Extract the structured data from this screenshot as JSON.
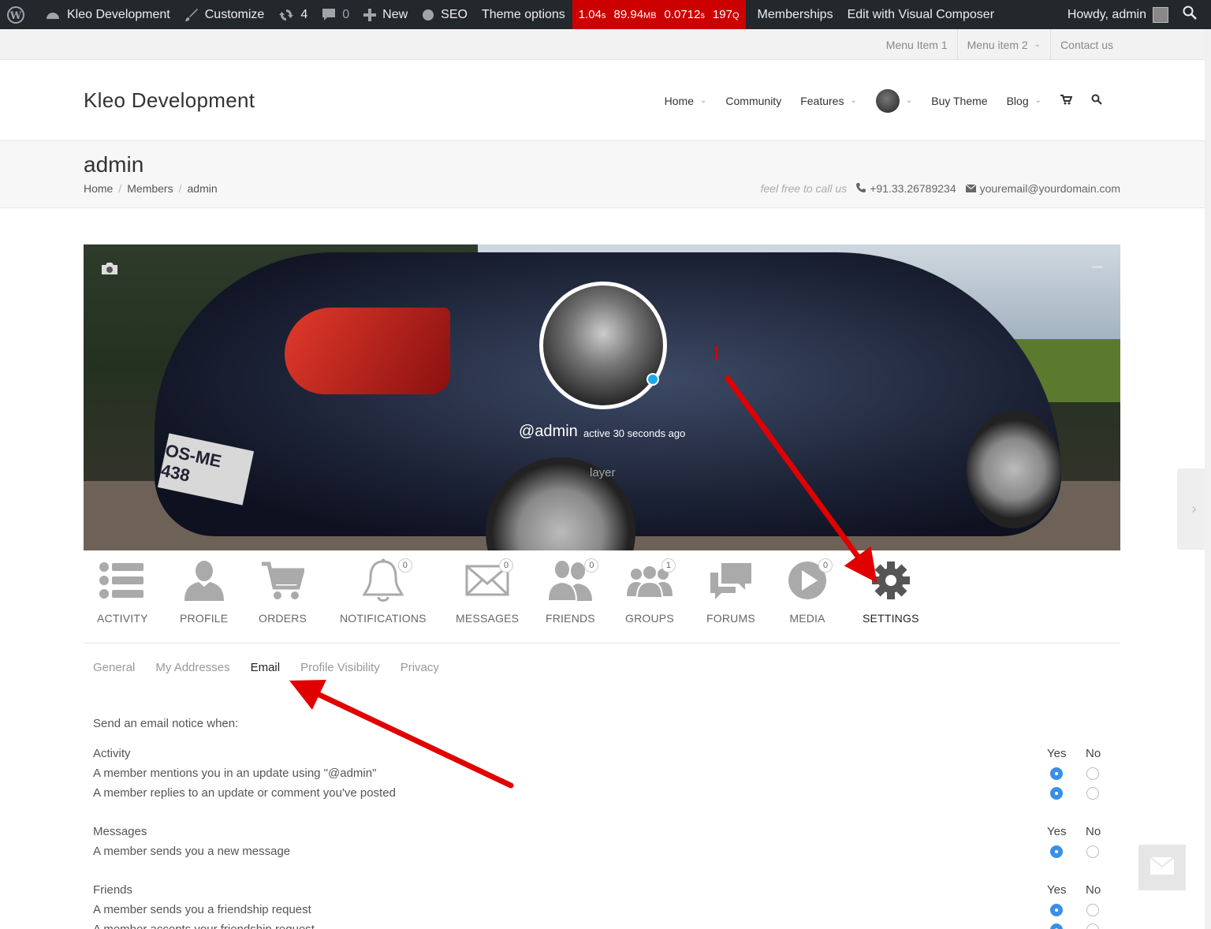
{
  "adminbar": {
    "site_name": "Kleo Development",
    "customize": "Customize",
    "updates_count": "4",
    "comments_count": "0",
    "new_label": "New",
    "seo_label": "SEO",
    "theme_options": "Theme options",
    "perf": {
      "time": "1.04s",
      "memory": "89.94MB",
      "query_time": "0.0712s",
      "queries": "197Q"
    },
    "memberships": "Memberships",
    "visual_composer": "Edit with Visual Composer",
    "howdy": "Howdy, admin",
    "color": "#23282d",
    "perf_color": "#cc0000"
  },
  "topmenu": [
    "Menu Item 1",
    "Menu item 2",
    "Contact us"
  ],
  "header": {
    "logo": "Kleo Development",
    "nav": [
      "Home",
      "Community",
      "Features",
      "Buy Theme",
      "Blog"
    ]
  },
  "titlebar": {
    "title": "admin",
    "breadcrumb": [
      "Home",
      "Members",
      "admin"
    ],
    "hint": "feel free to call us",
    "phone": "+91.33.26789234",
    "email": "youremail@yourdomain.com"
  },
  "cover": {
    "handle": "@admin",
    "active": "active 30 seconds ago",
    "layer": "layer",
    "plate": "OS-ME 438",
    "status_color": "#1ba9e9"
  },
  "profile_nav": [
    {
      "label": "ACTIVITY",
      "icon": "list-icon"
    },
    {
      "label": "PROFILE",
      "icon": "user-icon"
    },
    {
      "label": "ORDERS",
      "icon": "cart-icon"
    },
    {
      "label": "NOTIFICATIONS",
      "icon": "bell-icon",
      "badge": "0"
    },
    {
      "label": "MESSAGES",
      "icon": "envelope-icon",
      "badge": "0"
    },
    {
      "label": "FRIENDS",
      "icon": "friends-icon",
      "badge": "0"
    },
    {
      "label": "GROUPS",
      "icon": "group-icon",
      "badge": "1"
    },
    {
      "label": "FORUMS",
      "icon": "forum-icon"
    },
    {
      "label": "MEDIA",
      "icon": "play-icon",
      "badge": "0"
    },
    {
      "label": "SETTINGS",
      "icon": "gear-icon"
    }
  ],
  "subtabs": [
    "General",
    "My Addresses",
    "Email",
    "Profile Visibility",
    "Privacy"
  ],
  "email_settings": {
    "intro": "Send an email notice when:",
    "yes": "Yes",
    "no": "No",
    "sections": [
      {
        "title": "Activity",
        "rows": [
          "A member mentions you in an update using \"@admin\"",
          "A member replies to an update or comment you've posted"
        ]
      },
      {
        "title": "Messages",
        "rows": [
          "A member sends you a new message"
        ]
      },
      {
        "title": "Friends",
        "rows": [
          "A member sends you a friendship request",
          "A member accepts your friendship request"
        ]
      }
    ],
    "radio_color": "#3a8fe8"
  },
  "annotation": {
    "number": "1",
    "color": "#dd0000"
  }
}
